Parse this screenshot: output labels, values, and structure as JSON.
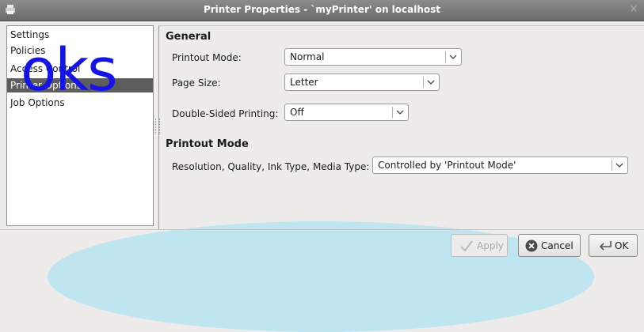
{
  "window": {
    "title": "Printer Properties - `myPrinter' on localhost",
    "close_glyph": "×"
  },
  "sidebar": {
    "items": [
      {
        "label": "Settings"
      },
      {
        "label": "Policies"
      },
      {
        "label": "Access Control"
      },
      {
        "label": "Printer Options",
        "selected": true
      },
      {
        "label": "Job Options"
      }
    ]
  },
  "overlay": {
    "text": "oks",
    "color": "#1414e6"
  },
  "general": {
    "heading": "General",
    "printout_mode": {
      "label": "Printout Mode:",
      "value": "Normal"
    },
    "page_size": {
      "label": "Page Size:",
      "value": "Letter"
    },
    "double_sided": {
      "label": "Double-Sided Printing:",
      "value": "Off"
    }
  },
  "printout_mode_section": {
    "heading": "Printout Mode",
    "resolution": {
      "label": "Resolution, Quality, Ink Type, Media Type:",
      "value": "Controlled by 'Printout Mode'"
    }
  },
  "buttons": {
    "apply": "Apply",
    "cancel": "Cancel",
    "ok": "OK"
  },
  "colors": {
    "selection": "#5d5d5d",
    "accent_arc": "#aee3f2",
    "titlebar": "#7b7b7b"
  }
}
